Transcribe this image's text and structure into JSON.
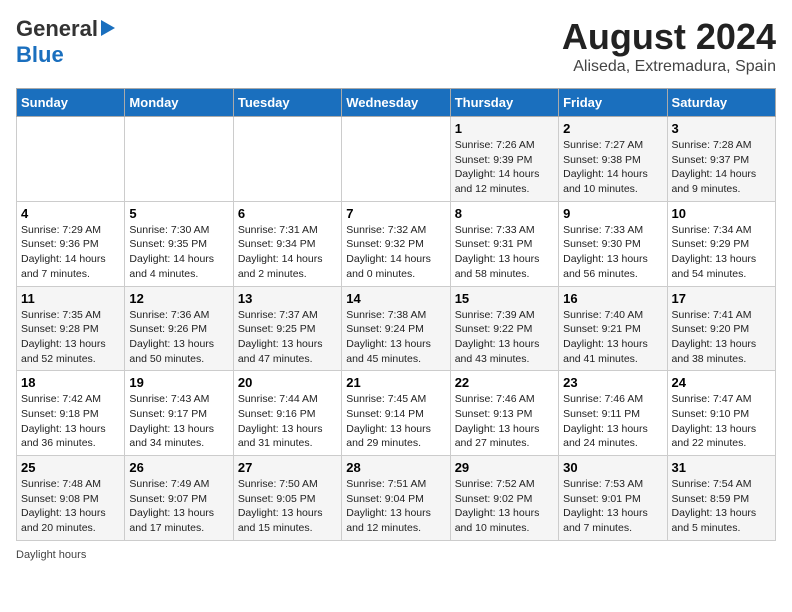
{
  "header": {
    "logo_line1": "General",
    "logo_line2": "Blue",
    "month_year": "August 2024",
    "location": "Aliseda, Extremadura, Spain"
  },
  "days_of_week": [
    "Sunday",
    "Monday",
    "Tuesday",
    "Wednesday",
    "Thursday",
    "Friday",
    "Saturday"
  ],
  "weeks": [
    [
      {
        "day": "",
        "info": ""
      },
      {
        "day": "",
        "info": ""
      },
      {
        "day": "",
        "info": ""
      },
      {
        "day": "",
        "info": ""
      },
      {
        "day": "1",
        "info": "Sunrise: 7:26 AM\nSunset: 9:39 PM\nDaylight: 14 hours and 12 minutes."
      },
      {
        "day": "2",
        "info": "Sunrise: 7:27 AM\nSunset: 9:38 PM\nDaylight: 14 hours and 10 minutes."
      },
      {
        "day": "3",
        "info": "Sunrise: 7:28 AM\nSunset: 9:37 PM\nDaylight: 14 hours and 9 minutes."
      }
    ],
    [
      {
        "day": "4",
        "info": "Sunrise: 7:29 AM\nSunset: 9:36 PM\nDaylight: 14 hours and 7 minutes."
      },
      {
        "day": "5",
        "info": "Sunrise: 7:30 AM\nSunset: 9:35 PM\nDaylight: 14 hours and 4 minutes."
      },
      {
        "day": "6",
        "info": "Sunrise: 7:31 AM\nSunset: 9:34 PM\nDaylight: 14 hours and 2 minutes."
      },
      {
        "day": "7",
        "info": "Sunrise: 7:32 AM\nSunset: 9:32 PM\nDaylight: 14 hours and 0 minutes."
      },
      {
        "day": "8",
        "info": "Sunrise: 7:33 AM\nSunset: 9:31 PM\nDaylight: 13 hours and 58 minutes."
      },
      {
        "day": "9",
        "info": "Sunrise: 7:33 AM\nSunset: 9:30 PM\nDaylight: 13 hours and 56 minutes."
      },
      {
        "day": "10",
        "info": "Sunrise: 7:34 AM\nSunset: 9:29 PM\nDaylight: 13 hours and 54 minutes."
      }
    ],
    [
      {
        "day": "11",
        "info": "Sunrise: 7:35 AM\nSunset: 9:28 PM\nDaylight: 13 hours and 52 minutes."
      },
      {
        "day": "12",
        "info": "Sunrise: 7:36 AM\nSunset: 9:26 PM\nDaylight: 13 hours and 50 minutes."
      },
      {
        "day": "13",
        "info": "Sunrise: 7:37 AM\nSunset: 9:25 PM\nDaylight: 13 hours and 47 minutes."
      },
      {
        "day": "14",
        "info": "Sunrise: 7:38 AM\nSunset: 9:24 PM\nDaylight: 13 hours and 45 minutes."
      },
      {
        "day": "15",
        "info": "Sunrise: 7:39 AM\nSunset: 9:22 PM\nDaylight: 13 hours and 43 minutes."
      },
      {
        "day": "16",
        "info": "Sunrise: 7:40 AM\nSunset: 9:21 PM\nDaylight: 13 hours and 41 minutes."
      },
      {
        "day": "17",
        "info": "Sunrise: 7:41 AM\nSunset: 9:20 PM\nDaylight: 13 hours and 38 minutes."
      }
    ],
    [
      {
        "day": "18",
        "info": "Sunrise: 7:42 AM\nSunset: 9:18 PM\nDaylight: 13 hours and 36 minutes."
      },
      {
        "day": "19",
        "info": "Sunrise: 7:43 AM\nSunset: 9:17 PM\nDaylight: 13 hours and 34 minutes."
      },
      {
        "day": "20",
        "info": "Sunrise: 7:44 AM\nSunset: 9:16 PM\nDaylight: 13 hours and 31 minutes."
      },
      {
        "day": "21",
        "info": "Sunrise: 7:45 AM\nSunset: 9:14 PM\nDaylight: 13 hours and 29 minutes."
      },
      {
        "day": "22",
        "info": "Sunrise: 7:46 AM\nSunset: 9:13 PM\nDaylight: 13 hours and 27 minutes."
      },
      {
        "day": "23",
        "info": "Sunrise: 7:46 AM\nSunset: 9:11 PM\nDaylight: 13 hours and 24 minutes."
      },
      {
        "day": "24",
        "info": "Sunrise: 7:47 AM\nSunset: 9:10 PM\nDaylight: 13 hours and 22 minutes."
      }
    ],
    [
      {
        "day": "25",
        "info": "Sunrise: 7:48 AM\nSunset: 9:08 PM\nDaylight: 13 hours and 20 minutes."
      },
      {
        "day": "26",
        "info": "Sunrise: 7:49 AM\nSunset: 9:07 PM\nDaylight: 13 hours and 17 minutes."
      },
      {
        "day": "27",
        "info": "Sunrise: 7:50 AM\nSunset: 9:05 PM\nDaylight: 13 hours and 15 minutes."
      },
      {
        "day": "28",
        "info": "Sunrise: 7:51 AM\nSunset: 9:04 PM\nDaylight: 13 hours and 12 minutes."
      },
      {
        "day": "29",
        "info": "Sunrise: 7:52 AM\nSunset: 9:02 PM\nDaylight: 13 hours and 10 minutes."
      },
      {
        "day": "30",
        "info": "Sunrise: 7:53 AM\nSunset: 9:01 PM\nDaylight: 13 hours and 7 minutes."
      },
      {
        "day": "31",
        "info": "Sunrise: 7:54 AM\nSunset: 8:59 PM\nDaylight: 13 hours and 5 minutes."
      }
    ]
  ],
  "footer": {
    "daylight_label": "Daylight hours"
  }
}
